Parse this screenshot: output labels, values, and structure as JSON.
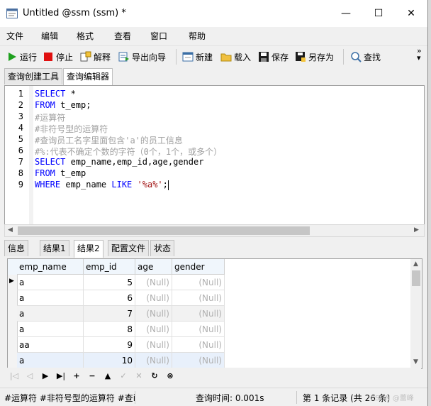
{
  "window": {
    "title": "Untitled @ssm (ssm) *",
    "minimize": "—",
    "maximize": "☐",
    "close": "✕"
  },
  "menu": [
    "文件",
    "编辑",
    "格式",
    "查看",
    "窗口",
    "帮助"
  ],
  "toolbar": {
    "run": "运行",
    "stop": "停止",
    "explain": "解释",
    "export": "导出向导",
    "new": "新建",
    "load": "载入",
    "save": "保存",
    "save_as": "另存为",
    "find": "查找",
    "more": "»"
  },
  "top_tabs": [
    "查询创建工具",
    "查询编辑器"
  ],
  "editor_lines": [
    {
      "n": "1",
      "parts": [
        {
          "t": "SELECT",
          "c": "kw"
        },
        {
          "t": " *",
          "c": ""
        }
      ]
    },
    {
      "n": "2",
      "parts": [
        {
          "t": "FROM",
          "c": "kw"
        },
        {
          "t": " t_emp;",
          "c": ""
        }
      ]
    },
    {
      "n": "3",
      "parts": [
        {
          "t": "#运算符",
          "c": "cm"
        }
      ]
    },
    {
      "n": "4",
      "parts": [
        {
          "t": "#非符号型的运算符",
          "c": "cm"
        }
      ]
    },
    {
      "n": "5",
      "parts": [
        {
          "t": "#查询员工名字里面包含'a'的员工信息",
          "c": "cm"
        }
      ]
    },
    {
      "n": "6",
      "parts": [
        {
          "t": "#%:代表不确定个数的字符（0个，1个，或多个）",
          "c": "cm"
        }
      ]
    },
    {
      "n": "7",
      "parts": [
        {
          "t": "SELECT",
          "c": "kw"
        },
        {
          "t": " emp_name,emp_id,age,gender",
          "c": ""
        }
      ]
    },
    {
      "n": "8",
      "parts": [
        {
          "t": "FROM",
          "c": "kw"
        },
        {
          "t": " t_emp",
          "c": ""
        }
      ]
    },
    {
      "n": "9",
      "parts": [
        {
          "t": "WHERE",
          "c": "kw"
        },
        {
          "t": " emp_name ",
          "c": ""
        },
        {
          "t": "LIKE",
          "c": "kw"
        },
        {
          "t": " ",
          "c": ""
        },
        {
          "t": "'%a%'",
          "c": "str"
        },
        {
          "t": ";",
          "c": ""
        }
      ]
    }
  ],
  "bottom_tabs": [
    "信息",
    "结果1",
    "结果2",
    "配置文件",
    "状态"
  ],
  "grid": {
    "columns": [
      "emp_name",
      "emp_id",
      "age",
      "gender"
    ],
    "rows": [
      [
        "a",
        "5",
        "(Null)",
        "(Null)"
      ],
      [
        "a",
        "6",
        "(Null)",
        "(Null)"
      ],
      [
        "a",
        "7",
        "(Null)",
        "(Null)"
      ],
      [
        "a",
        "8",
        "(Null)",
        "(Null)"
      ],
      [
        "aa",
        "9",
        "(Null)",
        "(Null)"
      ],
      [
        "a",
        "10",
        "(Null)",
        "(Null)"
      ]
    ]
  },
  "status": {
    "sql": "#运算符 #非符号型的运算符 #查i",
    "time": "查询时间: 0.001s",
    "records": "第 1 条记录 (共 26 条)",
    "watermark": "CSDN @蕾峰"
  },
  "colors": {
    "keyword": "#0000ff",
    "comment": "#a0a0a0",
    "string": "#a31515",
    "row_selected": "#e8f0fb"
  }
}
